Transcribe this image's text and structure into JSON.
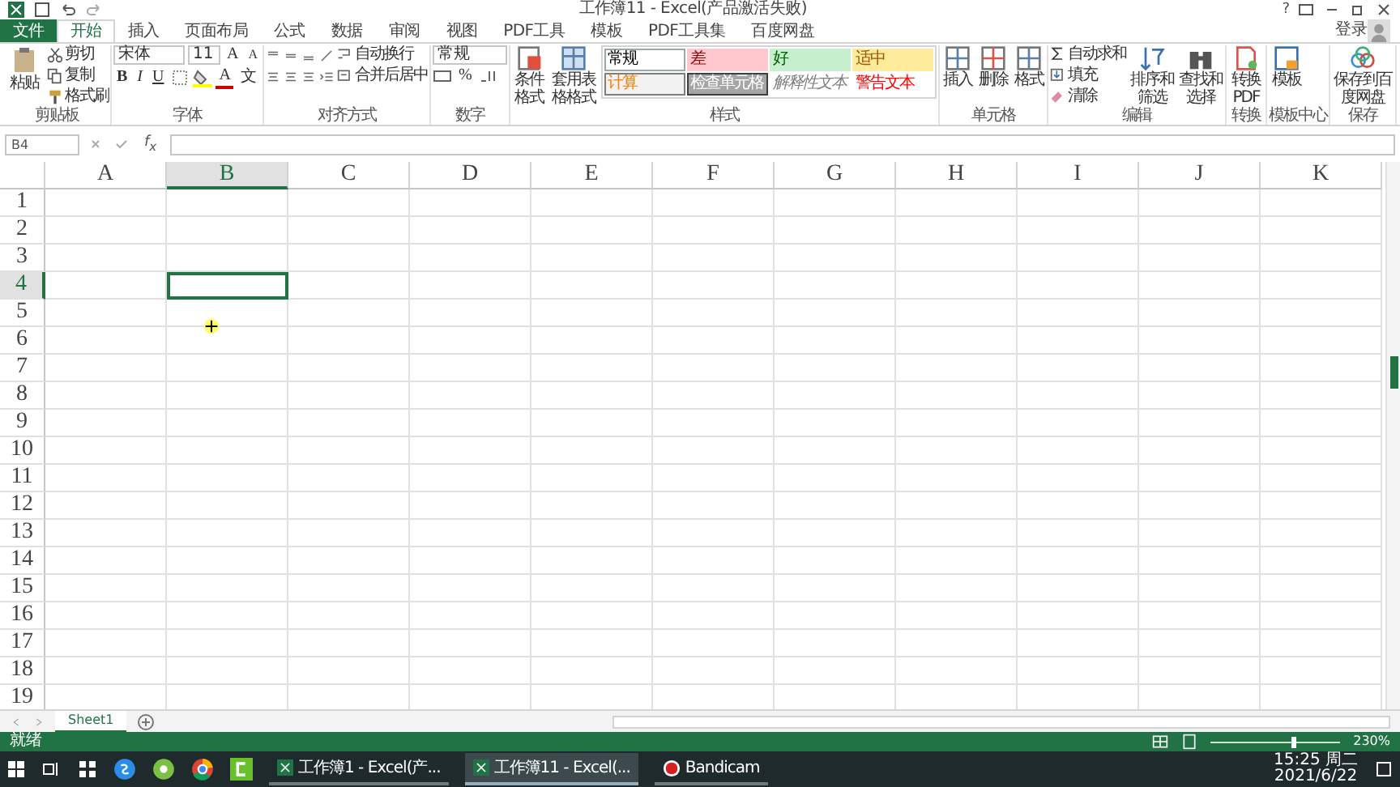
{
  "window": {
    "title": "工作簿11 - Excel(产品激活失败)",
    "help": "?",
    "account": "登录"
  },
  "ribbon_tabs": [
    {
      "label": "文件",
      "kind": "file",
      "selected": false
    },
    {
      "label": "开始",
      "kind": "tab",
      "selected": true
    },
    {
      "label": "插入",
      "kind": "tab",
      "selected": false
    },
    {
      "label": "页面布局",
      "kind": "tab",
      "selected": false
    },
    {
      "label": "公式",
      "kind": "tab",
      "selected": false
    },
    {
      "label": "数据",
      "kind": "tab",
      "selected": false
    },
    {
      "label": "审阅",
      "kind": "tab",
      "selected": false
    },
    {
      "label": "视图",
      "kind": "tab",
      "selected": false
    },
    {
      "label": "PDF工具",
      "kind": "tab",
      "selected": false
    },
    {
      "label": "模板",
      "kind": "tab",
      "selected": false
    },
    {
      "label": "PDF工具集",
      "kind": "tab",
      "selected": false
    },
    {
      "label": "百度网盘",
      "kind": "tab",
      "selected": false
    }
  ],
  "clipboard": {
    "paste": "粘贴",
    "cut": "剪切",
    "copy": "复制",
    "format_painter": "格式刷",
    "label": "剪贴板"
  },
  "font": {
    "name": "宋体",
    "size": "11",
    "grow": "A",
    "shrink": "A",
    "bold": "B",
    "italic": "I",
    "underline": "U",
    "font_color": "A",
    "phonetic": "文",
    "label": "字体"
  },
  "alignment": {
    "wrap": "自动换行",
    "merge": "合并后居中",
    "label": "对齐方式"
  },
  "number": {
    "format": "常规",
    "percent": "%",
    "label": "数字"
  },
  "styles": {
    "conditional": "条件格式",
    "table": "套用表格格式",
    "label": "样式",
    "gallery": [
      {
        "label": "常规",
        "kind": "normal"
      },
      {
        "label": "差",
        "kind": "bad"
      },
      {
        "label": "好",
        "kind": "good"
      },
      {
        "label": "适中",
        "kind": "neutral"
      },
      {
        "label": "计算",
        "kind": "calculation"
      },
      {
        "label": "检查单元格",
        "kind": "check"
      },
      {
        "label": "解释性文本",
        "kind": "explanatory"
      },
      {
        "label": "警告文本",
        "kind": "warning"
      }
    ]
  },
  "cells": {
    "insert": "插入",
    "delete": "删除",
    "format": "格式",
    "label": "单元格"
  },
  "editing": {
    "autosum": "自动求和",
    "fill": "填充",
    "clear": "清除",
    "sort": "排序和筛选",
    "find": "查找和选择",
    "label": "编辑"
  },
  "convert": {
    "button": "转换PDF",
    "label": "转换"
  },
  "template": {
    "button": "模板",
    "label": "模板中心"
  },
  "save": {
    "button": "保存到百度网盘",
    "label": "保存"
  },
  "formula_bar": {
    "name_box": "B4",
    "function_label": "f$_{x}$"
  },
  "columns": [
    {
      "label": "A",
      "selected": false
    },
    {
      "label": "B",
      "selected": true
    },
    {
      "label": "C",
      "selected": false
    },
    {
      "label": "D",
      "selected": false
    },
    {
      "label": "E",
      "selected": false
    },
    {
      "label": "F",
      "selected": false
    },
    {
      "label": "G",
      "selected": false
    },
    {
      "label": "H",
      "selected": false
    },
    {
      "label": "I",
      "selected": false
    },
    {
      "label": "J",
      "selected": false
    },
    {
      "label": "K",
      "selected": false
    }
  ],
  "rows": [
    {
      "label": "1",
      "selected": false
    },
    {
      "label": "2",
      "selected": false
    },
    {
      "label": "3",
      "selected": false
    },
    {
      "label": "4",
      "selected": true
    },
    {
      "label": "5",
      "selected": false
    },
    {
      "label": "6",
      "selected": false
    },
    {
      "label": "7",
      "selected": false
    },
    {
      "label": "8",
      "selected": false
    },
    {
      "label": "9",
      "selected": false
    },
    {
      "label": "10",
      "selected": false
    },
    {
      "label": "11",
      "selected": false
    },
    {
      "label": "12",
      "selected": false
    },
    {
      "label": "13",
      "selected": false
    },
    {
      "label": "14",
      "selected": false
    },
    {
      "label": "15",
      "selected": false
    },
    {
      "label": "16",
      "selected": false
    },
    {
      "label": "17",
      "selected": false
    },
    {
      "label": "18",
      "selected": false
    },
    {
      "label": "19",
      "selected": false
    }
  ],
  "sheet_tabs": [
    {
      "label": "Sheet1",
      "selected": true
    }
  ],
  "status_bar": {
    "status": "就绪",
    "zoom": {
      "reading": "230%",
      "level": 0.62
    }
  },
  "taskbar": {
    "windows": [
      {
        "label": "工作簿1 - Excel(产...",
        "selected": false,
        "kind": "excel"
      },
      {
        "label": "工作簿11 - Excel(...",
        "selected": true,
        "kind": "excel"
      },
      {
        "label": "Bandicam",
        "selected": false,
        "kind": "record"
      }
    ],
    "time": "15:25 周二",
    "date": "2021/6/22"
  }
}
